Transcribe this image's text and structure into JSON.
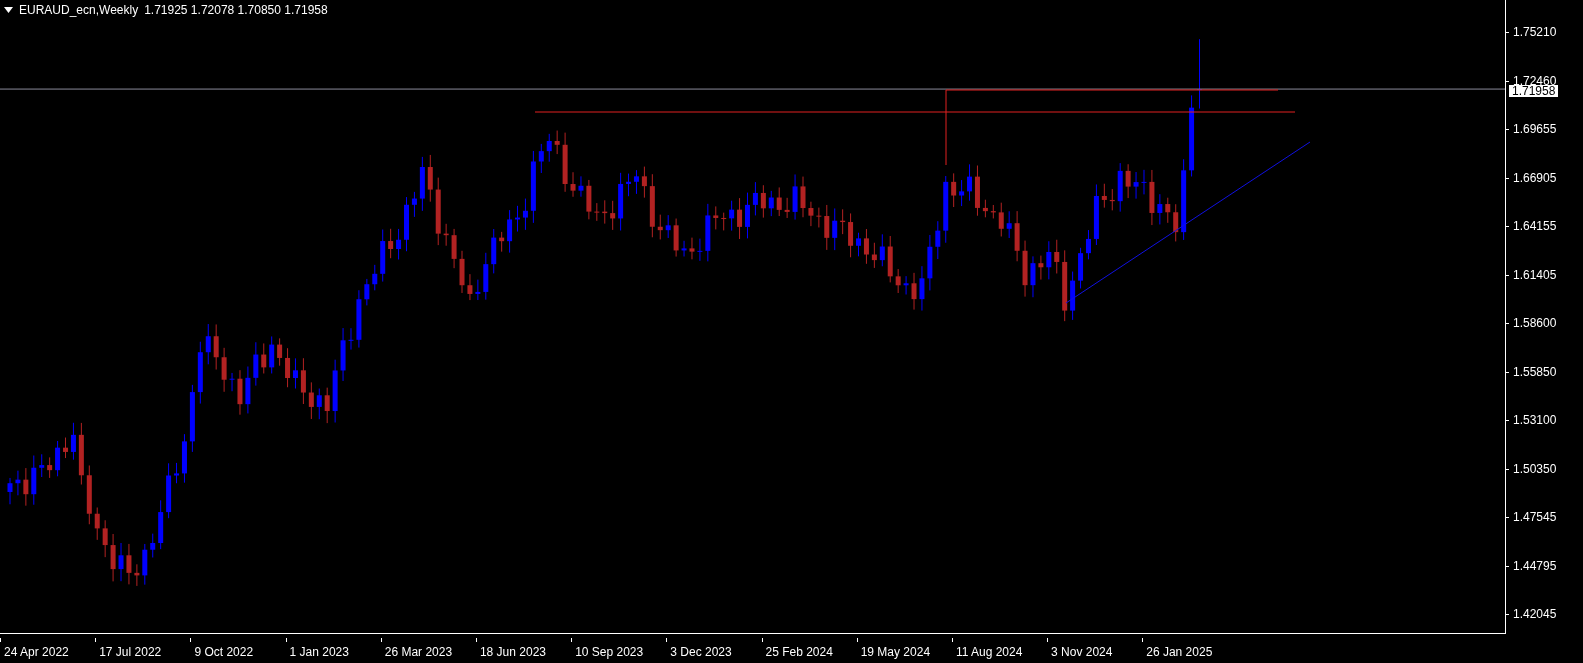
{
  "header": {
    "symbol": "EURAUD_ecn,Weekly",
    "ohlc": "1.71925 1.72078 1.70850 1.71958"
  },
  "price_axis": {
    "labels": [
      "1.75210",
      "1.72460",
      "1.69655",
      "1.66905",
      "1.64155",
      "1.61405",
      "1.58600",
      "1.55850",
      "1.53100",
      "1.50350",
      "1.47545",
      "1.44795",
      "1.42045"
    ],
    "current_price": "1.71958"
  },
  "time_axis": {
    "labels": [
      "24 Apr 2022",
      "17 Jul 2022",
      "9 Oct 2022",
      "1 Jan 2023",
      "26 Mar 2023",
      "18 Jun 2023",
      "10 Sep 2023",
      "3 Dec 2023",
      "25 Feb 2024",
      "19 May 2024",
      "11 Aug 2024",
      "3 Nov 2024",
      "26 Jan 2025"
    ]
  }
}
